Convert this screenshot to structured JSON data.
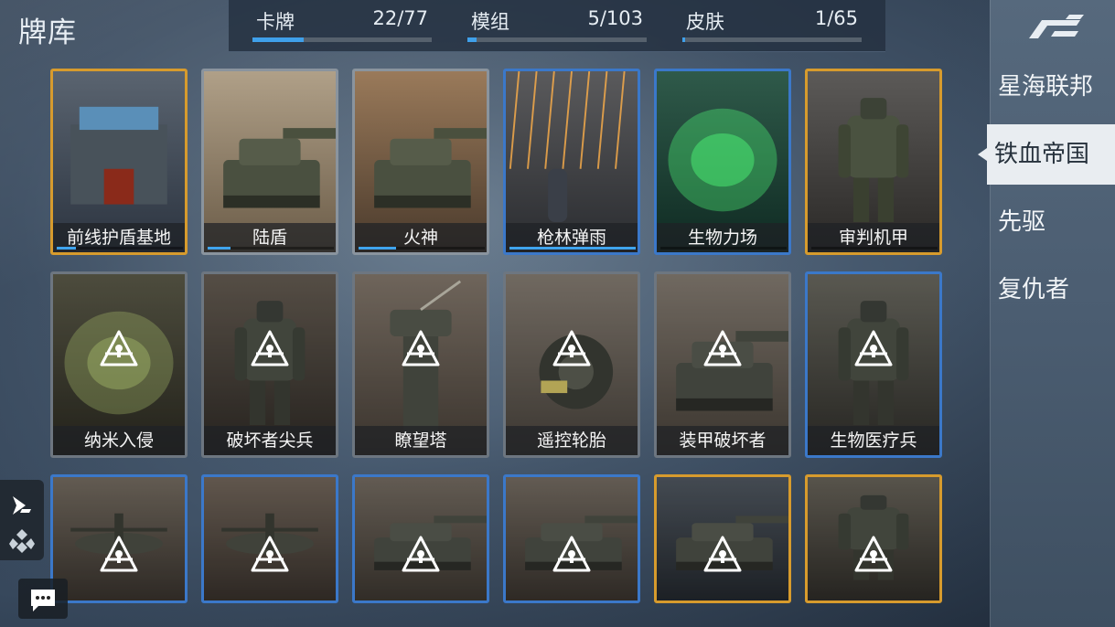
{
  "title": "牌库",
  "stats": [
    {
      "label": "卡牌",
      "count": "22/77",
      "progress": 0.286
    },
    {
      "label": "模组",
      "count": "5/103",
      "progress": 0.049
    },
    {
      "label": "皮肤",
      "count": "1/65",
      "progress": 0.015
    }
  ],
  "factions": [
    {
      "label": "星海联邦",
      "active": false
    },
    {
      "label": "铁血帝国",
      "active": true
    },
    {
      "label": "先驱",
      "active": false
    },
    {
      "label": "复仇者",
      "active": false
    }
  ],
  "cards": [
    {
      "name": "前线护盾基地",
      "rarity": "gold",
      "locked": false,
      "progress": 0.15,
      "art": "base"
    },
    {
      "name": "陆盾",
      "rarity": "gray",
      "locked": false,
      "progress": 0.18,
      "art": "tank"
    },
    {
      "name": "火神",
      "rarity": "gray",
      "locked": false,
      "progress": 0.3,
      "art": "cannon"
    },
    {
      "name": "枪林弹雨",
      "rarity": "blue",
      "locked": false,
      "progress": 1.0,
      "art": "rain"
    },
    {
      "name": "生物力场",
      "rarity": "blue",
      "locked": false,
      "progress": 0.0,
      "art": "bio"
    },
    {
      "name": "审判机甲",
      "rarity": "gold",
      "locked": false,
      "progress": 0.0,
      "art": "mech"
    },
    {
      "name": "纳米入侵",
      "rarity": "dark",
      "locked": true,
      "art": "nano"
    },
    {
      "name": "破坏者尖兵",
      "rarity": "dark",
      "locked": true,
      "art": "mech2"
    },
    {
      "name": "瞭望塔",
      "rarity": "dark",
      "locked": true,
      "art": "tower"
    },
    {
      "name": "遥控轮胎",
      "rarity": "dark",
      "locked": true,
      "art": "wheel"
    },
    {
      "name": "装甲破坏者",
      "rarity": "dark",
      "locked": true,
      "art": "tank2"
    },
    {
      "name": "生物医疗兵",
      "rarity": "blue",
      "locked": true,
      "art": "medic"
    },
    {
      "name": "",
      "rarity": "blue",
      "locked": true,
      "art": "heli"
    },
    {
      "name": "",
      "rarity": "blue",
      "locked": true,
      "art": "jet"
    },
    {
      "name": "",
      "rarity": "blue",
      "locked": true,
      "art": "artillery"
    },
    {
      "name": "",
      "rarity": "blue",
      "locked": true,
      "art": "tank3"
    },
    {
      "name": "",
      "rarity": "gold",
      "locked": true,
      "art": "tank4"
    },
    {
      "name": "",
      "rarity": "gold",
      "locked": true,
      "art": "mech3"
    }
  ],
  "colors": {
    "accent": "#3fa0ea",
    "gold": "#d79b2d",
    "blue": "#3b78c9"
  }
}
